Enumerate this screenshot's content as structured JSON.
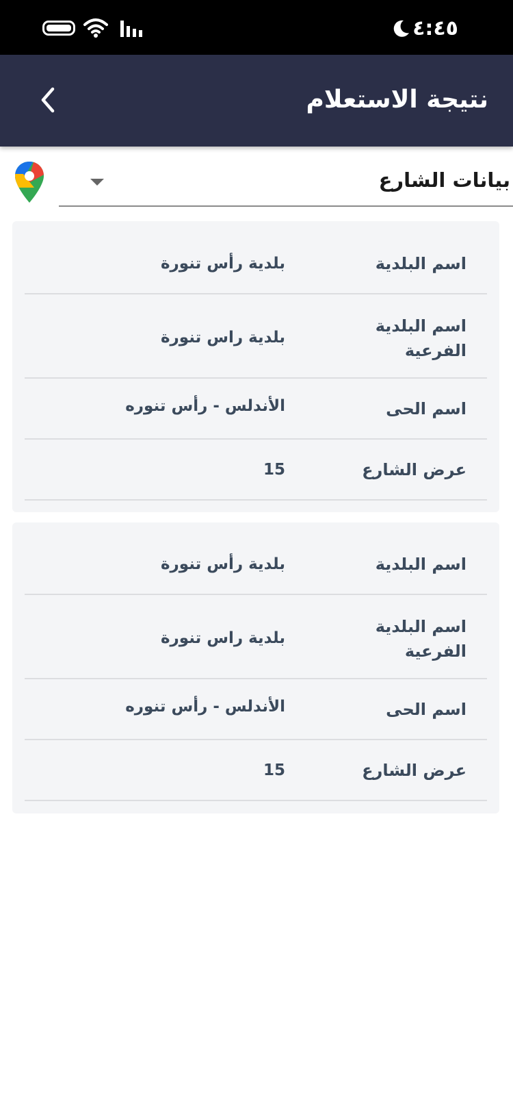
{
  "status_bar": {
    "time": "٤:٤٥",
    "icons": [
      "battery-icon",
      "wifi-icon",
      "signal-icon",
      "moon-icon"
    ]
  },
  "header": {
    "title": "نتيجة الاستعلام",
    "back_icon": "chevron-left-icon",
    "background": "#2b2f48"
  },
  "selector": {
    "selected": "بيانات الشارع",
    "maps_icon": "google-maps-pin-icon"
  },
  "cards": [
    {
      "rows": [
        {
          "label": "اسم البلدية",
          "value": "بلدية رأس تنورة"
        },
        {
          "label": "اسم البلدية الفرعية",
          "value": "بلدية راس تنورة"
        },
        {
          "label": "اسم الحى",
          "value": "الأندلس - رأس تنوره"
        },
        {
          "label": "عرض الشارع",
          "value": "15"
        }
      ]
    },
    {
      "rows": [
        {
          "label": "اسم البلدية",
          "value": "بلدية رأس تنورة"
        },
        {
          "label": "اسم البلدية الفرعية",
          "value": "بلدية راس تنورة"
        },
        {
          "label": "اسم الحى",
          "value": "الأندلس - رأس تنوره"
        },
        {
          "label": "عرض الشارع",
          "value": "15"
        }
      ]
    }
  ]
}
